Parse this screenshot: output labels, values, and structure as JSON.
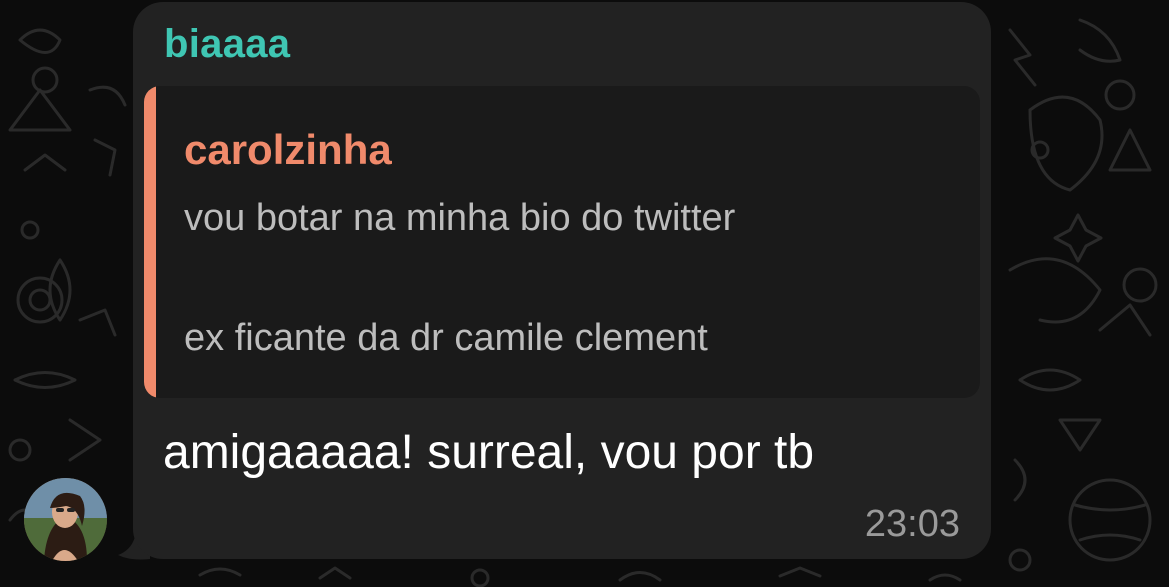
{
  "message": {
    "sender": "biaaaa",
    "quoted": {
      "author": "carolzinha",
      "lines": [
        "vou botar na minha bio do twitter",
        "ex ficante da dr camile clement"
      ]
    },
    "text": "amigaaaaa! surreal, vou por tb",
    "time": "23:03"
  },
  "colors": {
    "sender_name": "#3fc6b3",
    "quote_accent": "#f08a6b",
    "bubble": "#222222",
    "background": "#0c0c0c"
  },
  "icons": {
    "avatar": "contact-photo",
    "background": "chat-doodle-wallpaper"
  }
}
